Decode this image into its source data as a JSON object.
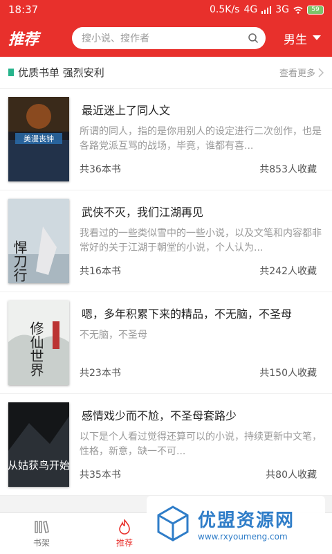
{
  "status": {
    "time": "18:37",
    "speed": "0.5K/s",
    "net1": "4G",
    "net2": "3G",
    "battery": "59"
  },
  "header": {
    "title": "推荐",
    "search_placeholder": "搜小说、搜作者",
    "gender": "男生"
  },
  "section": {
    "title": "优质书单 强烈安利",
    "more": "查看更多"
  },
  "items": [
    {
      "title": "最近迷上了同人文",
      "desc": "所谓的同人，指的是你用别人的设定进行二次创作，也是各路党派互骂的战场，毕竟，谁都有喜...",
      "count": "共36本书",
      "fav": "共853人收藏",
      "cover_text": "美漫丧钟"
    },
    {
      "title": "武侠不灭，我们江湖再见",
      "desc": "我看过的一些类似雪中的一些小说，以及文笔和内容都非常好的关于江湖于朝堂的小说，个人认为...",
      "count": "共16本书",
      "fav": "共242人收藏",
      "cover_text": "悍刀行"
    },
    {
      "title": "嗯，多年积累下来的精品，不无脑，不圣母",
      "desc": "不无脑，不圣母",
      "count": "共23本书",
      "fav": "共150人收藏",
      "cover_text": "修仙世界"
    },
    {
      "title": "感情戏少而不尬，不圣母套路少",
      "desc": "以下是个人看过觉得还算可以的小说，持续更新中文笔，性格，新意，缺一不可...",
      "count": "共35本书",
      "fav": "共80人收藏",
      "cover_text": "从姑获鸟开始"
    }
  ],
  "tabs": [
    {
      "label": "书架",
      "icon": "bookshelf-icon"
    },
    {
      "label": "推荐",
      "icon": "flame-icon"
    }
  ],
  "watermark": {
    "title": "优盟资源网",
    "url": "www.rxyoumeng.com"
  },
  "colors": {
    "primary": "#e8302c",
    "accent_green": "#27b48c",
    "watermark_blue": "#2f7dc8"
  }
}
